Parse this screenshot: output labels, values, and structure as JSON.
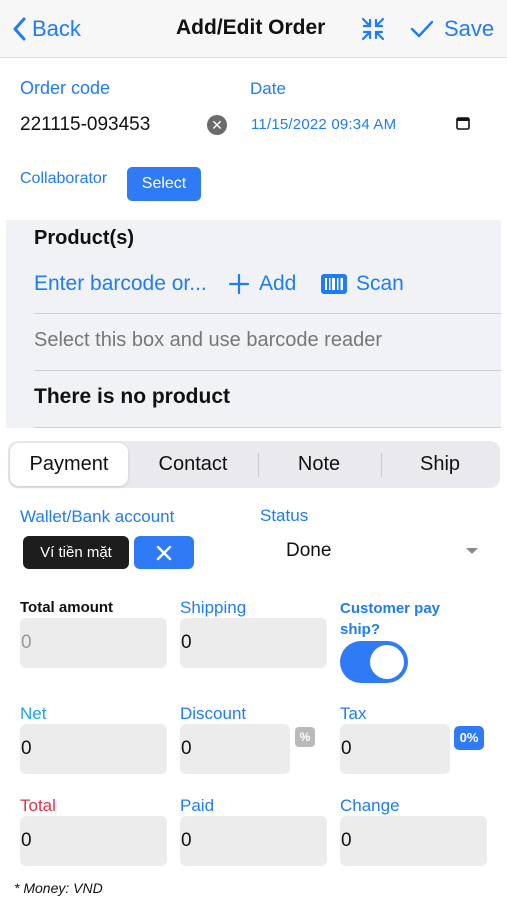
{
  "header": {
    "back_label": "Back",
    "title": "Add/Edit Order",
    "save_label": "Save"
  },
  "order": {
    "code_label": "Order code",
    "code_value": "221115-093453",
    "date_label": "Date",
    "date_value": "11/15/2022 09:34 AM",
    "collaborator_label": "Collaborator",
    "select_label": "Select"
  },
  "products": {
    "title": "Product(s)",
    "barcode_placeholder": "Enter barcode or...",
    "add_label": "Add",
    "scan_label": "Scan",
    "reader_placeholder": "Select this box and use barcode reader",
    "empty_text": "There is no product"
  },
  "tabs": [
    {
      "label": "Payment",
      "active": true
    },
    {
      "label": "Contact",
      "active": false
    },
    {
      "label": "Note",
      "active": false
    },
    {
      "label": "Ship",
      "active": false
    }
  ],
  "payment": {
    "wallet_label": "Wallet/Bank account",
    "wallet_chip": "Ví tiền mặt",
    "status_label": "Status",
    "status_value": "Done",
    "total_amount_label": "Total amount",
    "total_amount_value": "0",
    "shipping_label": "Shipping",
    "shipping_value": "0",
    "customer_pay_ship_label_1": "Customer pay",
    "customer_pay_ship_label_2": "ship?",
    "customer_pay_ship_on": true,
    "net_label": "Net",
    "net_value": "0",
    "discount_label": "Discount",
    "discount_value": "0",
    "discount_badge": "%",
    "tax_label": "Tax",
    "tax_value": "0",
    "tax_badge": "0%",
    "total_label": "Total",
    "total_value": "0",
    "paid_label": "Paid",
    "paid_value": "0",
    "change_label": "Change",
    "change_value": "0",
    "money_note": "* Money: VND"
  },
  "colors": {
    "accent": "#1f7cf5",
    "button": "#2f7bf5",
    "net_label": "#1aa6e8",
    "total_label": "#e0334d"
  }
}
